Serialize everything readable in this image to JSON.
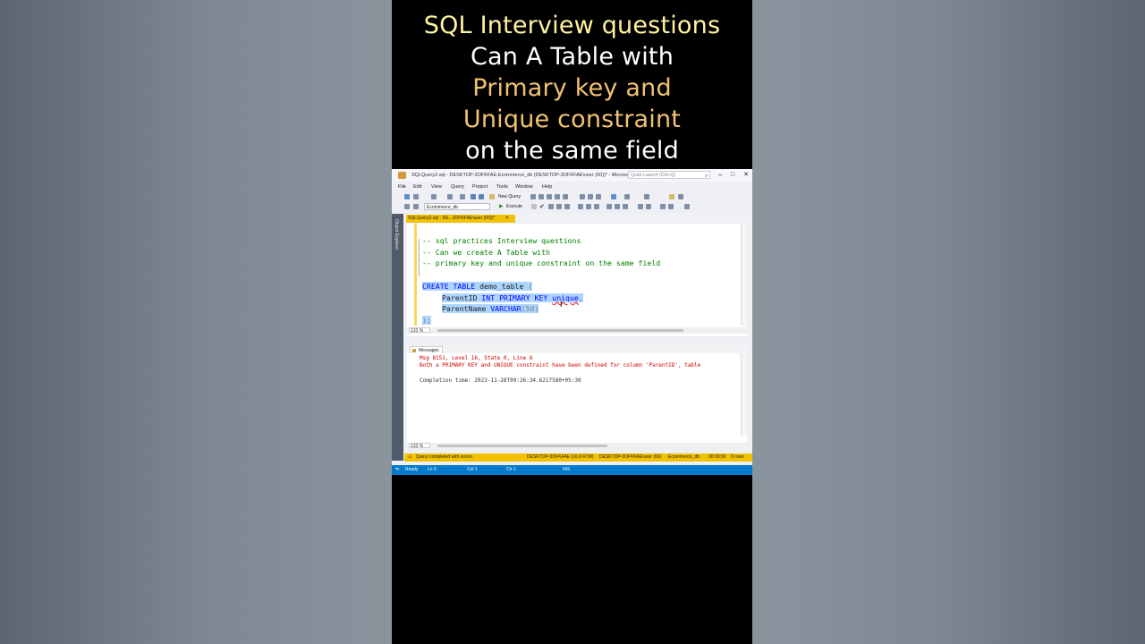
{
  "overlay": {
    "line1": "SQL Interview questions",
    "line2": "Can A Table with",
    "line3": "Primary key and",
    "line4": "Unique constraint",
    "line5": "on the same field"
  },
  "window": {
    "title": "SQLQuery2.sql - DESKTOP-3OFKFAE.Ecommerce_db (DESKTOP-3OFKFAE\\user (60))* - Microsoft...",
    "quick_launch_placeholder": "Quick Launch (Ctrl+Q)",
    "minimize": "–",
    "restore": "□",
    "close": "✕"
  },
  "menu": [
    "File",
    "Edit",
    "View",
    "Query",
    "Project",
    "Tools",
    "Window",
    "Help"
  ],
  "toolbar": {
    "new_query": "New Query",
    "database": "Ecommerce_db",
    "execute": "Execute"
  },
  "object_explorer_label": "Object Explorer",
  "doc_tab": {
    "label": "SQLQuery2.sql - DE...3OFKFAE\\user (60))*",
    "pin": "⌂",
    "close": "✕"
  },
  "editor": {
    "comments": [
      "-- sql practices Interview questions",
      "-- Can we create A Table with",
      "-- primary key and unique constraint on the same field"
    ],
    "create_kw": "CREATE TABLE",
    "table_name": " demo_table ",
    "open_paren": "(",
    "col1_name": "ParentID ",
    "col1_type": "INT PRIMARY KEY",
    "col1_unique": "unique",
    "col1_comma": ",",
    "col2_name": "ParentName ",
    "col2_type": "VARCHAR",
    "col2_len": "(50)",
    "close": ");",
    "zoom": "133 %"
  },
  "results": {
    "tab_label": "Messages",
    "line1": "Msg 8151, Level 16, State 0, Line 6",
    "line2": "Both a PRIMARY KEY and UNIQUE constraint have been defined for column 'ParentID', table",
    "line3": "Completion time: 2023-11-28T09:26:34.6217580+05:30",
    "zoom": "133 %"
  },
  "query_status": {
    "message": "Query completed with errors.",
    "server": "DESKTOP-3OFKFAE (16.0 RTM)",
    "user": "DESKTOP-3OFKFAE\\user (60)",
    "database": "Ecommerce_db",
    "time": "00:00:00",
    "rows": "0 rows"
  },
  "status_bar": {
    "ready": "Ready",
    "ln": "Ln 6",
    "col": "Col 1",
    "ch": "Ch 1",
    "ins": "INS"
  }
}
